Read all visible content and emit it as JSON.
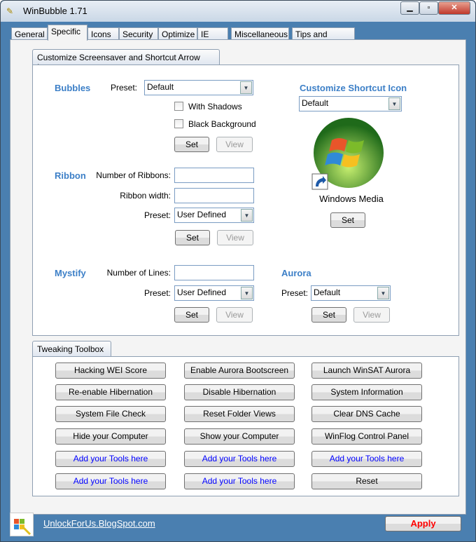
{
  "window": {
    "title": "WinBubble 1.71"
  },
  "tabs": [
    "General",
    "Specific",
    "Icons",
    "Security",
    "Optimize",
    "IE",
    "Miscellaneous",
    "Tips and Tricks"
  ],
  "screensaver_group": {
    "title": "Customize Screensaver and Shortcut Arrow Icon",
    "bubbles": {
      "heading": "Bubbles",
      "preset_label": "Preset:",
      "preset_value": "Default",
      "with_shadows": "With Shadows",
      "black_background": "Black Background",
      "set": "Set",
      "view": "View"
    },
    "ribbon": {
      "heading": "Ribbon",
      "num_label": "Number of Ribbons:",
      "width_label": "Ribbon width:",
      "num_value": "",
      "width_value": "",
      "preset_label": "Preset:",
      "preset_value": "User Defined",
      "set": "Set",
      "view": "View"
    },
    "mystify": {
      "heading": "Mystify",
      "lines_label": "Number of Lines:",
      "lines_value": "",
      "preset_label": "Preset:",
      "preset_value": "User Defined",
      "set": "Set",
      "view": "View"
    },
    "aurora": {
      "heading": "Aurora",
      "preset_label": "Preset:",
      "preset_value": "Default",
      "set": "Set",
      "view": "View"
    },
    "shortcut": {
      "heading": "Customize Shortcut Icon",
      "value": "Default",
      "icon_caption": "Windows Media",
      "set": "Set"
    }
  },
  "toolbox": {
    "title": "Tweaking Toolbox",
    "buttons": [
      [
        "Hacking WEI Score",
        "Enable Aurora Bootscreen",
        "Launch WinSAT Aurora"
      ],
      [
        "Re-enable Hibernation",
        "Disable Hibernation",
        "System Information"
      ],
      [
        "System File Check",
        "Reset Folder Views",
        "Clear DNS Cache"
      ],
      [
        "Hide your Computer",
        "Show your Computer",
        "WinFlog Control Panel"
      ],
      [
        "Add your Tools here",
        "Add your Tools here",
        "Add your Tools here"
      ],
      [
        "Add your Tools here",
        "Add your Tools here",
        "Reset"
      ]
    ]
  },
  "footer": {
    "link": "UnlockForUs.BlogSpot.com",
    "apply": "Apply"
  }
}
